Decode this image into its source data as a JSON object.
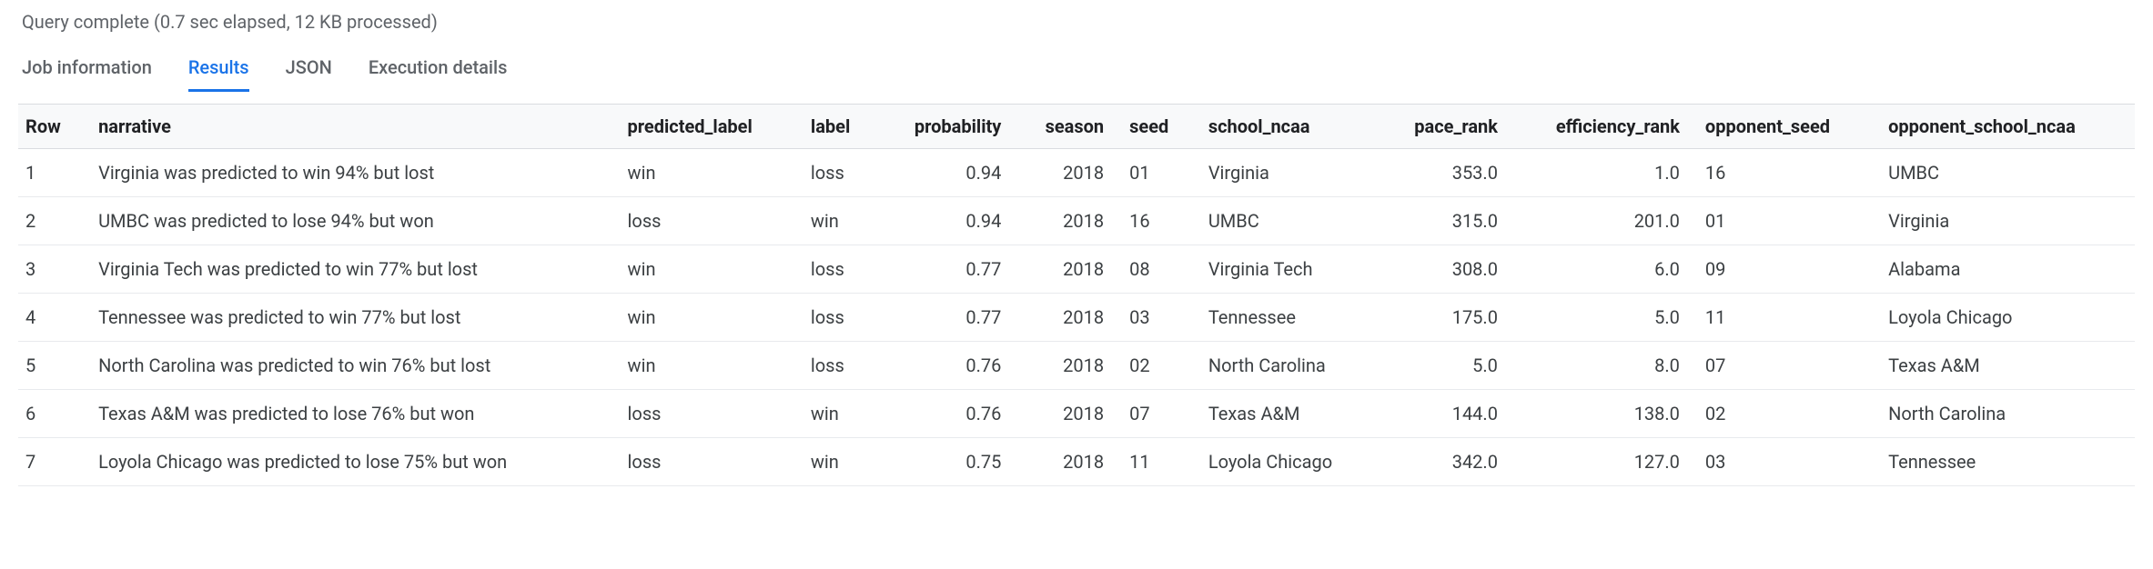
{
  "status": "Query complete (0.7 sec elapsed, 12 KB processed)",
  "tabs": [
    {
      "label": "Job information",
      "active": false
    },
    {
      "label": "Results",
      "active": true
    },
    {
      "label": "JSON",
      "active": false
    },
    {
      "label": "Execution details",
      "active": false
    }
  ],
  "columns": [
    {
      "key": "row",
      "label": "Row",
      "align": "left"
    },
    {
      "key": "narrative",
      "label": "narrative",
      "align": "left"
    },
    {
      "key": "predicted_label",
      "label": "predicted_label",
      "align": "left"
    },
    {
      "key": "label",
      "label": "label",
      "align": "left"
    },
    {
      "key": "probability",
      "label": "probability",
      "align": "right"
    },
    {
      "key": "season",
      "label": "season",
      "align": "right"
    },
    {
      "key": "seed",
      "label": "seed",
      "align": "left"
    },
    {
      "key": "school_ncaa",
      "label": "school_ncaa",
      "align": "left"
    },
    {
      "key": "pace_rank",
      "label": "pace_rank",
      "align": "right"
    },
    {
      "key": "efficiency_rank",
      "label": "efficiency_rank",
      "align": "right"
    },
    {
      "key": "opponent_seed",
      "label": "opponent_seed",
      "align": "left"
    },
    {
      "key": "opponent_school_ncaa",
      "label": "opponent_school_ncaa",
      "align": "left"
    }
  ],
  "rows": [
    {
      "row": "1",
      "narrative": "Virginia was predicted to win 94% but lost",
      "predicted_label": "win",
      "label": "loss",
      "probability": "0.94",
      "season": "2018",
      "seed": "01",
      "school_ncaa": "Virginia",
      "pace_rank": "353.0",
      "efficiency_rank": "1.0",
      "opponent_seed": "16",
      "opponent_school_ncaa": "UMBC"
    },
    {
      "row": "2",
      "narrative": "UMBC was predicted to lose 94% but won",
      "predicted_label": "loss",
      "label": "win",
      "probability": "0.94",
      "season": "2018",
      "seed": "16",
      "school_ncaa": "UMBC",
      "pace_rank": "315.0",
      "efficiency_rank": "201.0",
      "opponent_seed": "01",
      "opponent_school_ncaa": "Virginia"
    },
    {
      "row": "3",
      "narrative": "Virginia Tech was predicted to win 77% but lost",
      "predicted_label": "win",
      "label": "loss",
      "probability": "0.77",
      "season": "2018",
      "seed": "08",
      "school_ncaa": "Virginia Tech",
      "pace_rank": "308.0",
      "efficiency_rank": "6.0",
      "opponent_seed": "09",
      "opponent_school_ncaa": "Alabama"
    },
    {
      "row": "4",
      "narrative": "Tennessee was predicted to win 77% but lost",
      "predicted_label": "win",
      "label": "loss",
      "probability": "0.77",
      "season": "2018",
      "seed": "03",
      "school_ncaa": "Tennessee",
      "pace_rank": "175.0",
      "efficiency_rank": "5.0",
      "opponent_seed": "11",
      "opponent_school_ncaa": "Loyola Chicago"
    },
    {
      "row": "5",
      "narrative": "North Carolina was predicted to win 76% but lost",
      "predicted_label": "win",
      "label": "loss",
      "probability": "0.76",
      "season": "2018",
      "seed": "02",
      "school_ncaa": "North Carolina",
      "pace_rank": "5.0",
      "efficiency_rank": "8.0",
      "opponent_seed": "07",
      "opponent_school_ncaa": "Texas A&M"
    },
    {
      "row": "6",
      "narrative": "Texas A&M was predicted to lose 76% but won",
      "predicted_label": "loss",
      "label": "win",
      "probability": "0.76",
      "season": "2018",
      "seed": "07",
      "school_ncaa": "Texas A&M",
      "pace_rank": "144.0",
      "efficiency_rank": "138.0",
      "opponent_seed": "02",
      "opponent_school_ncaa": "North Carolina"
    },
    {
      "row": "7",
      "narrative": "Loyola Chicago was predicted to lose 75% but won",
      "predicted_label": "loss",
      "label": "win",
      "probability": "0.75",
      "season": "2018",
      "seed": "11",
      "school_ncaa": "Loyola Chicago",
      "pace_rank": "342.0",
      "efficiency_rank": "127.0",
      "opponent_seed": "03",
      "opponent_school_ncaa": "Tennessee"
    }
  ]
}
